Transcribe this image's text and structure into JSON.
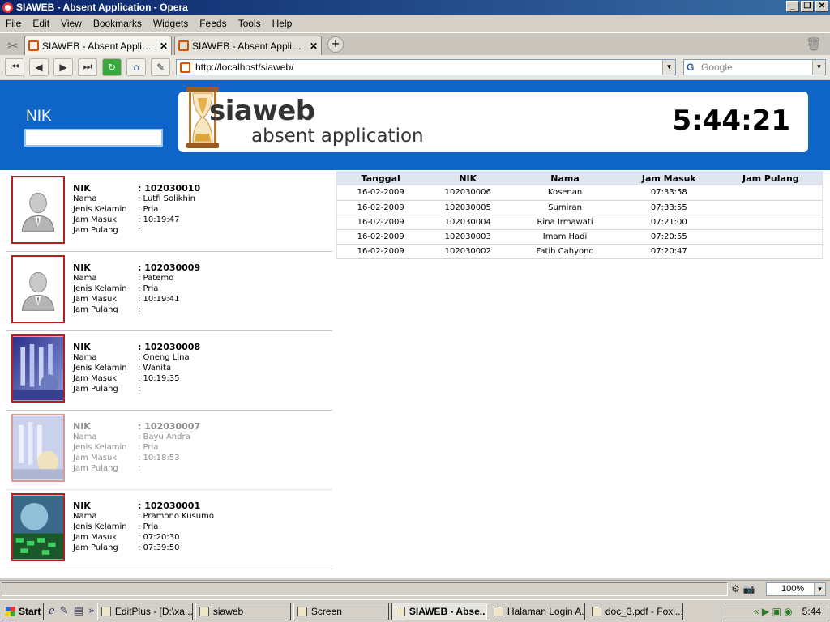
{
  "window": {
    "title": "SIAWEB - Absent Application - Opera"
  },
  "menu": [
    "File",
    "Edit",
    "View",
    "Bookmarks",
    "Widgets",
    "Feeds",
    "Tools",
    "Help"
  ],
  "tabs": [
    {
      "label": "SIAWEB - Absent Application",
      "active": true
    },
    {
      "label": "SIAWEB - Absent Applicati...",
      "active": false
    }
  ],
  "nav": {
    "url": "http://localhost/siaweb/",
    "search_placeholder": "Google"
  },
  "page": {
    "nik_label": "NIK",
    "nik_value": "",
    "logo_title": "siaweb",
    "logo_subtitle": "absent application",
    "clock": "5:44:21"
  },
  "field_labels": {
    "nik": "NIK",
    "nama": "Nama",
    "jk": "Jenis Kelamin",
    "masuk": "Jam Masuk",
    "pulang": "Jam Pulang"
  },
  "employees": [
    {
      "nik": ": 102030010",
      "nama": ": Lutfi Solikhin",
      "jk": ": Pria",
      "masuk": ": 10:19:47",
      "pulang": ":"
    },
    {
      "nik": ": 102030009",
      "nama": ": Patemo",
      "jk": ": Pria",
      "masuk": ": 10:19:41",
      "pulang": ":"
    },
    {
      "nik": ": 102030008",
      "nama": ": Oneng Lina",
      "jk": ": Wanita",
      "masuk": ": 10:19:35",
      "pulang": ":"
    },
    {
      "nik": ": 102030007",
      "nama": ": Bayu Andra",
      "jk": ": Pria",
      "masuk": ": 10:18:53",
      "pulang": ":"
    },
    {
      "nik": ": 102030001",
      "nama": ": Pramono Kusumo",
      "jk": ": Pria",
      "masuk": ": 07:20:30",
      "pulang": ": 07:39:50"
    }
  ],
  "table": {
    "headers": [
      "Tanggal",
      "NIK",
      "Nama",
      "Jam Masuk",
      "Jam Pulang"
    ],
    "rows": [
      [
        "16-02-2009",
        "102030006",
        "Kosenan",
        "07:33:58",
        ""
      ],
      [
        "16-02-2009",
        "102030005",
        "Sumiran",
        "07:33:55",
        ""
      ],
      [
        "16-02-2009",
        "102030004",
        "Rina Irmawati",
        "07:21:00",
        ""
      ],
      [
        "16-02-2009",
        "102030003",
        "Imam Hadi",
        "07:20:55",
        ""
      ],
      [
        "16-02-2009",
        "102030002",
        "Fatih Cahyono",
        "07:20:47",
        ""
      ]
    ]
  },
  "statusbar": {
    "zoom": "100%"
  },
  "taskbar": {
    "start": "Start",
    "tasks": [
      {
        "label": "EditPlus - [D:\\xa...",
        "active": false
      },
      {
        "label": "siaweb",
        "active": false
      },
      {
        "label": "Screen",
        "active": false
      },
      {
        "label": "SIAWEB - Abse...",
        "active": true
      },
      {
        "label": "Halaman Login A...",
        "active": false
      },
      {
        "label": "doc_3.pdf - Foxi...",
        "active": false
      }
    ],
    "clock": "5:44"
  }
}
